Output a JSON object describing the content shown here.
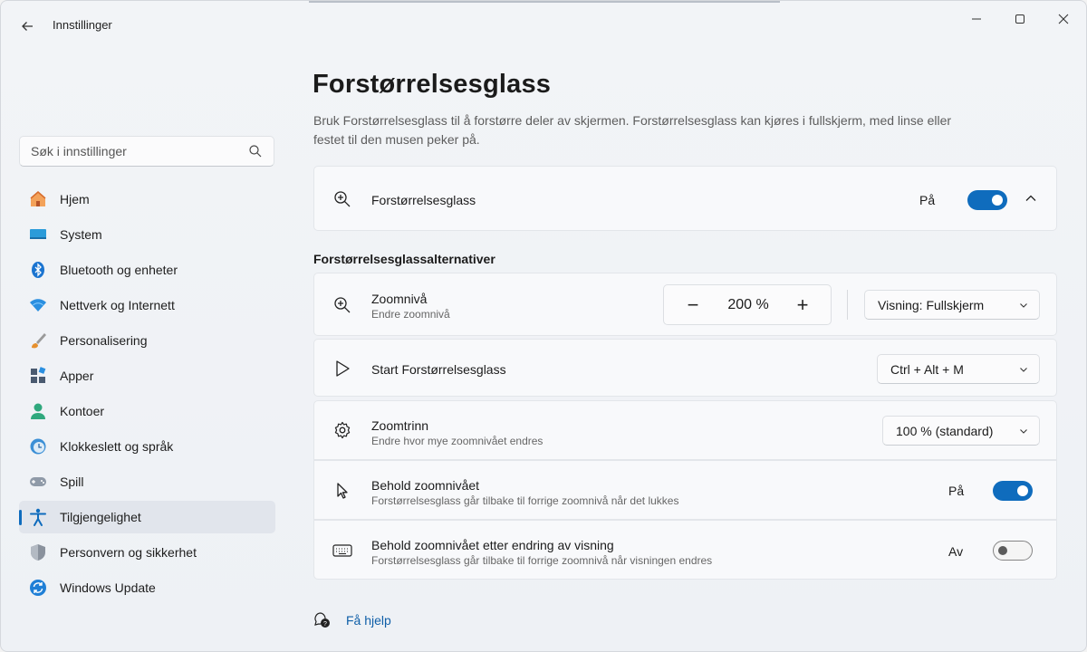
{
  "window": {
    "title": "Innstillinger",
    "controls": [
      "minimize",
      "maximize",
      "close"
    ]
  },
  "search": {
    "placeholder": "Søk i innstillinger"
  },
  "sidebar": {
    "items": [
      {
        "label": "Hjem",
        "icon": "home-icon"
      },
      {
        "label": "System",
        "icon": "system-icon"
      },
      {
        "label": "Bluetooth og enheter",
        "icon": "bluetooth-icon"
      },
      {
        "label": "Nettverk og Internett",
        "icon": "wifi-icon"
      },
      {
        "label": "Personalisering",
        "icon": "brush-icon"
      },
      {
        "label": "Apper",
        "icon": "apps-icon"
      },
      {
        "label": "Kontoer",
        "icon": "account-icon"
      },
      {
        "label": "Klokkeslett og språk",
        "icon": "clock-globe-icon"
      },
      {
        "label": "Spill",
        "icon": "gamepad-icon"
      },
      {
        "label": "Tilgjengelighet",
        "icon": "accessibility-icon",
        "active": true
      },
      {
        "label": "Personvern og sikkerhet",
        "icon": "shield-icon"
      },
      {
        "label": "Windows Update",
        "icon": "update-icon"
      }
    ]
  },
  "main": {
    "title": "Forstørrelsesglass",
    "description": "Bruk Forstørrelsesglass til å forstørre deler av skjermen. Forstørrelsesglass kan kjøres i fullskjerm, med linse eller festet til den musen peker på.",
    "magnifier": {
      "label": "Forstørrelsesglass",
      "state": "På",
      "on": true
    },
    "section_header": "Forstørrelsesglassalternativer",
    "zoom": {
      "title": "Zoomnivå",
      "subtitle": "Endre zoomnivå",
      "minus": "−",
      "value": "200 %",
      "plus": "+",
      "view_dropdown": "Visning: Fullskjerm"
    },
    "start": {
      "title": "Start Forstørrelsesglass",
      "shortcut": "Ctrl + Alt + M"
    },
    "zoom_step": {
      "title": "Zoomtrinn",
      "subtitle": "Endre hvor mye zoomnivået endres",
      "value": "100 % (standard)"
    },
    "keep_zoom": {
      "title": "Behold zoomnivået",
      "subtitle": "Forstørrelsesglass går tilbake til forrige zoomnivå når det lukkes",
      "state": "På",
      "on": true
    },
    "keep_zoom_view": {
      "title": "Behold zoomnivået etter endring av visning",
      "subtitle": "Forstørrelsesglass går tilbake til forrige zoomnivå når visningen endres",
      "state": "Av",
      "on": false
    },
    "help": {
      "label": "Få hjelp"
    }
  },
  "colors": {
    "accent": "#0f6cbd",
    "link": "#0f5fa8"
  }
}
